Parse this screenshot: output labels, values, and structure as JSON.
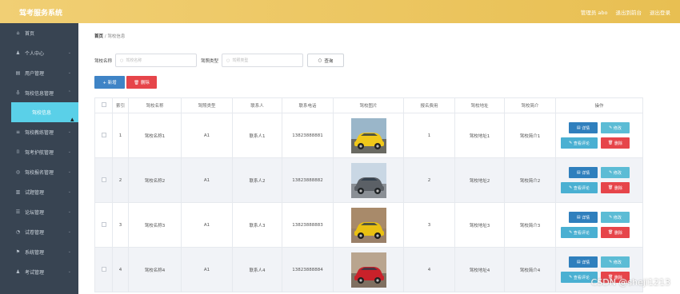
{
  "header": {
    "app_title": "驾考服务系统",
    "links": [
      "管理员 abo",
      "退出到前台",
      "退出登录"
    ]
  },
  "sidebar": {
    "items": [
      {
        "icon": "home-icon",
        "glyph": "⌂",
        "label": "首页",
        "arrow": false
      },
      {
        "icon": "user-icon",
        "glyph": "♟",
        "label": "个人中心",
        "arrow": true
      },
      {
        "icon": "users-icon",
        "glyph": "▤",
        "label": "用户管理",
        "arrow": true
      },
      {
        "icon": "school-icon",
        "glyph": "♁",
        "label": "驾校信息管理",
        "arrow": true,
        "open": true,
        "sub": [
          "驾校信息"
        ]
      },
      {
        "icon": "coach-icon",
        "glyph": "≡",
        "label": "驾校教练管理",
        "arrow": true
      },
      {
        "icon": "license-icon",
        "glyph": "⌷",
        "label": "驾考护航管理",
        "arrow": true
      },
      {
        "icon": "report-icon",
        "glyph": "◎",
        "label": "驾校报名管理",
        "arrow": true
      },
      {
        "icon": "exam-icon",
        "glyph": "▥",
        "label": "试题管理",
        "arrow": true
      },
      {
        "icon": "forum-icon",
        "glyph": "☰",
        "label": "论坛管理",
        "arrow": true
      },
      {
        "icon": "test-icon",
        "glyph": "◔",
        "label": "试卷管理",
        "arrow": true
      },
      {
        "icon": "system-icon",
        "glyph": "⚑",
        "label": "系统管理",
        "arrow": true
      },
      {
        "icon": "exam-manage-icon",
        "glyph": "♟",
        "label": "考试管理",
        "arrow": true
      }
    ]
  },
  "breadcrumb": {
    "home": "首页",
    "sep": "/",
    "current": "驾校信息"
  },
  "search": {
    "label1": "驾校名称",
    "placeholder1": "驾校名称",
    "label2": "驾照类型",
    "placeholder2": "驾照类型",
    "query_label": "查询"
  },
  "actions": {
    "add": "+ 新增",
    "delete": "🗑 删除"
  },
  "table": {
    "headers": [
      "",
      "索引",
      "驾校名称",
      "驾照类型",
      "联系人",
      "联系电话",
      "驾校图片",
      "报名费用",
      "驾校地址",
      "驾校简介",
      "操作"
    ],
    "rows": [
      {
        "index": "1",
        "name": "驾校名称1",
        "type": "A1",
        "contact": "联系人1",
        "phone": "13823888881",
        "fee": "1",
        "addr": "驾校地址1",
        "intro": "驾校简介1",
        "photo": "yellow"
      },
      {
        "index": "2",
        "name": "驾校名称2",
        "type": "A1",
        "contact": "联系人2",
        "phone": "13823888882",
        "fee": "2",
        "addr": "驾校地址2",
        "intro": "驾校简介2",
        "photo": "gray"
      },
      {
        "index": "3",
        "name": "驾校名称3",
        "type": "A1",
        "contact": "联系人3",
        "phone": "13823888883",
        "fee": "3",
        "addr": "驾校地址3",
        "intro": "驾校简介3",
        "photo": "camaro"
      },
      {
        "index": "4",
        "name": "驾校名称4",
        "type": "A1",
        "contact": "联系人4",
        "phone": "13823888884",
        "fee": "4",
        "addr": "驾校地址4",
        "intro": "驾校简介4",
        "photo": "red"
      }
    ],
    "ops": {
      "detail": "详情",
      "edit": "修改",
      "comments": "查看评论",
      "remove": "删除"
    }
  },
  "watermark": "CSDN @sheji1213",
  "colors": {
    "topbar": "#e8bf52",
    "sidebar": "#384452",
    "active": "#5ad0e8",
    "primary": "#2f7fbd",
    "danger": "#e6454a"
  }
}
